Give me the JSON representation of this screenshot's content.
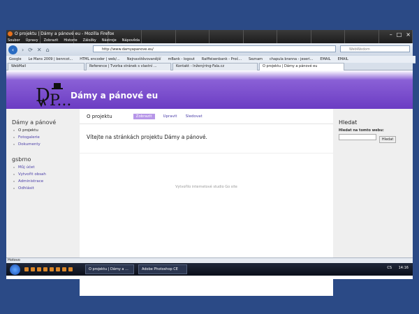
{
  "browser": {
    "title": "O projektu | Dámy a pánové eu - Mozilla Firefox",
    "menu": [
      "Soubor",
      "Úpravy",
      "Zobrazit",
      "Historie",
      "Záložky",
      "Nástroje",
      "Nápověda"
    ],
    "url": "http://www.damyapanove.eu/",
    "search_placeholder": "WebWedom",
    "bookmarks": [
      "Google",
      "Le Mans 2009 | benrcot...",
      "HTML encoder | web/...",
      "Nejnavštěvovanější",
      "mBank - logout",
      "Raiffeisenbank - Proč...",
      "Seznam",
      "chapula branna - jeseri...",
      "EMAIL",
      "EMAIL"
    ],
    "tabs": [
      "WebMail",
      "Reference | Tvorba stránek s vlastní ...",
      "Kontakt - Inženýring-Fala.cz",
      "O projektu | Dámy a pánové eu"
    ],
    "status": "Hotovo"
  },
  "site": {
    "name": "Dámy a pánové eu",
    "logo_text": "D P...",
    "left": {
      "block1_title": "Dámy a pánové",
      "block1_items": [
        "O projektu",
        "Fotogalerie",
        "Dokumenty"
      ],
      "block2_title": "gsbrno",
      "block2_items": [
        "Můj účet",
        "Vytvořit obsah",
        "Administrace",
        "Odhlásit"
      ]
    },
    "main": {
      "title": "O projektu",
      "tabs": [
        "Zobrazit",
        "Upravit",
        "Sledovat"
      ],
      "welcome": "Vítejte na stránkách projektu Dámy a pánové.",
      "footer": "Vytvořilo internetové studio Go site"
    },
    "search": {
      "title": "Hledat",
      "label": "Hledat na tomto webu:",
      "button": "Hledat"
    }
  },
  "taskbar": {
    "tasks": [
      "O projektu | Dámy a ...",
      "Adobe Photoshop CE"
    ],
    "tray": "CS",
    "clock": "14:16"
  }
}
